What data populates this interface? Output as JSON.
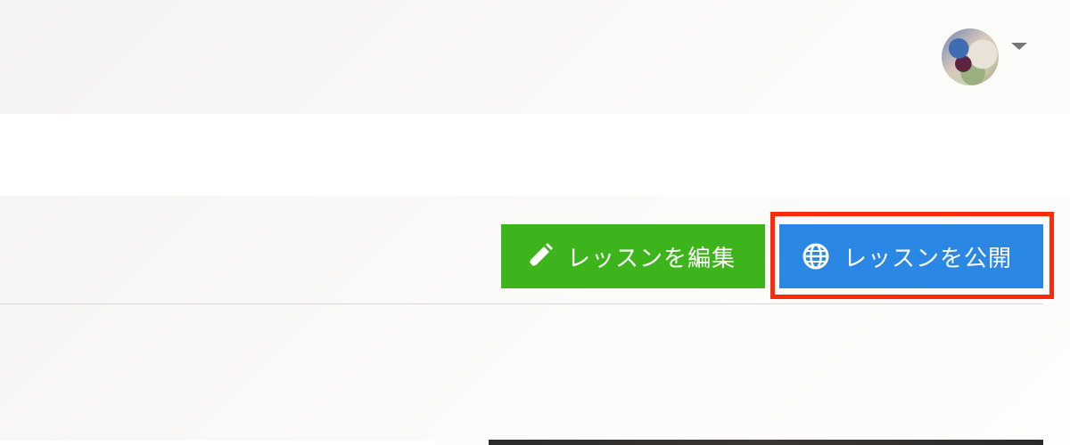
{
  "header": {
    "avatar": {
      "icon": "user-avatar"
    },
    "menu_caret": {
      "icon": "caret-down-icon"
    }
  },
  "lesson_actions": {
    "edit": {
      "label": "レッスンを編集",
      "icon": "pencil-icon",
      "color": "#3db41c"
    },
    "publish": {
      "label": "レッスンを公開",
      "icon": "globe-icon",
      "color": "#2a87e3",
      "highlight_color": "#ff2a0a"
    }
  }
}
